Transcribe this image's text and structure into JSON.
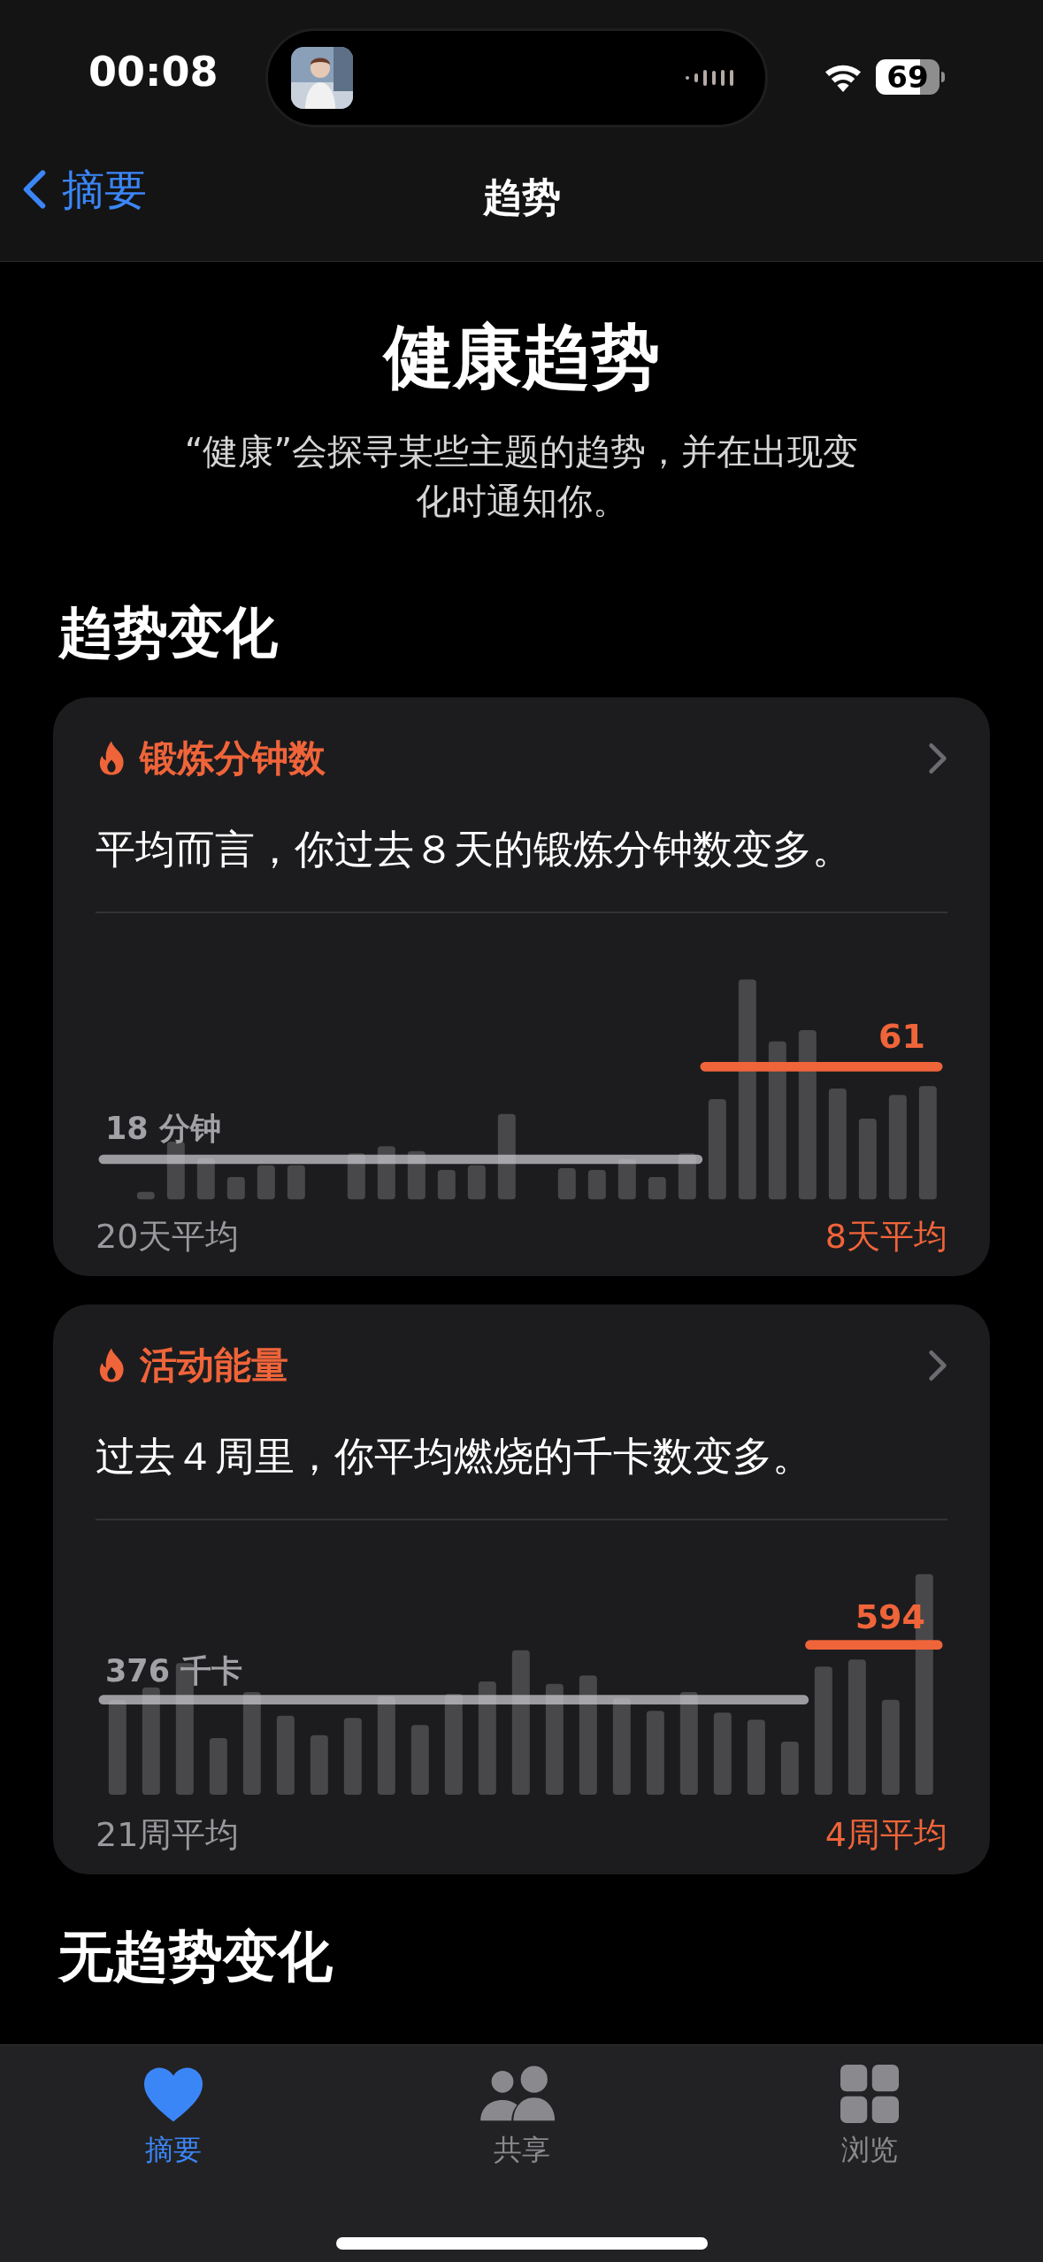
{
  "status_bar": {
    "time": "00:08",
    "battery": "69"
  },
  "nav": {
    "back": "摘要",
    "title": "趋势"
  },
  "title": "健康趋势",
  "subtitle": "“健康”会探寻某些主题的趋势，并在出现变化时通知你。",
  "section": "趋势变化",
  "cards": [
    {
      "title": "锻炼分钟数",
      "sentence": "平均而言，你过去８天的锻炼分钟数变多。",
      "baseline_label": "18 分钟",
      "recent_label": "61",
      "baseline_period": "20天平均",
      "recent_period": "8天平均"
    },
    {
      "title": "活动能量",
      "sentence": "过去４周里，你平均燃烧的千卡数变多。",
      "baseline_label": "376 千卡",
      "recent_label": "594",
      "baseline_period": "21周平均",
      "recent_period": "4周平均"
    }
  ],
  "next_section": "无趋势变化",
  "tabs": [
    {
      "label": "摘要",
      "selected": true
    },
    {
      "label": "共享",
      "selected": false
    },
    {
      "label": "浏览",
      "selected": false
    }
  ]
}
